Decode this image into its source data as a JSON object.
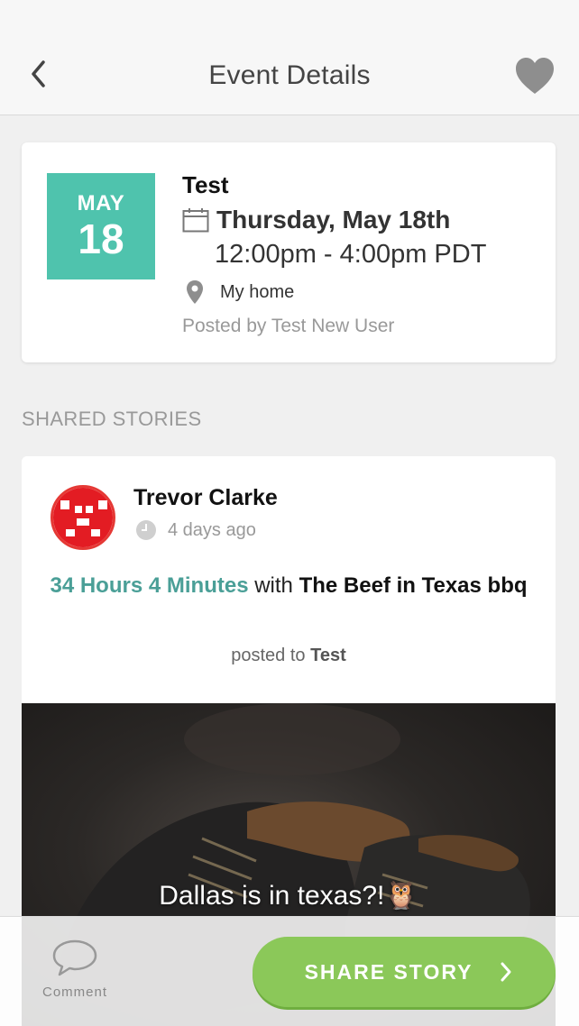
{
  "header": {
    "title": "Event Details"
  },
  "event": {
    "month": "MAY",
    "day": "18",
    "title": "Test",
    "date": "Thursday, May 18th",
    "time": "12:00pm - 4:00pm PDT",
    "location": "My home",
    "posted_by": "Posted by Test New User"
  },
  "section": {
    "heading": "SHARED STORIES"
  },
  "story": {
    "author": "Trevor Clarke",
    "time_ago": "4 days ago",
    "duration": "34 Hours 4 Minutes",
    "with_word": "with",
    "place": "The Beef in Texas bbq",
    "posted_to_prefix": "posted to",
    "posted_to_event": "Test",
    "caption": "Dallas is in texas?!🦉"
  },
  "bottom_bar": {
    "comment_label": "Comment",
    "share_label": "SHARE STORY"
  },
  "colors": {
    "accent_teal": "#4fc3ad",
    "duration_teal": "#4a9f97",
    "share_green": "#8bc859",
    "avatar_red": "#e53935"
  }
}
